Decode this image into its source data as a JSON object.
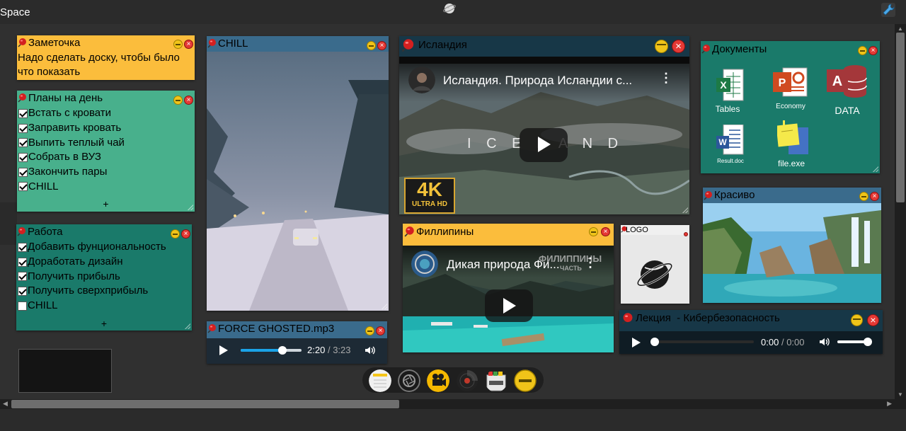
{
  "app": {
    "title": "Space"
  },
  "icons": {
    "logo": "planet-icon",
    "settings": "wrench-icon",
    "pin": "pushpin-icon",
    "minimize": "minus-circle-icon",
    "close": "close-circle-icon"
  },
  "colors": {
    "background": "#2b2b2b",
    "note_yellow": "#fbbd3c",
    "note_green": "#48b08c",
    "note_teal": "#1a7a6a",
    "panel_blue": "#3a6b8c",
    "panel_dark": "#173747",
    "docs_green": "#1a7a6a"
  },
  "note": {
    "title": "Заметочка",
    "text": "Надо сделать доску, чтобы было что показать"
  },
  "daily": {
    "title": "Планы на день",
    "add_label": "+",
    "items": [
      {
        "label": "Встать с кровати",
        "checked": true
      },
      {
        "label": "Заправить кровать",
        "checked": true
      },
      {
        "label": "Выпить теплый чай",
        "checked": true
      },
      {
        "label": "Собрать в ВУЗ",
        "checked": true
      },
      {
        "label": "Закончить пары",
        "checked": true
      },
      {
        "label": "CHILL",
        "checked": true
      }
    ]
  },
  "work": {
    "title": "Работа",
    "add_label": "+",
    "items": [
      {
        "label": "Добавить фунциональность",
        "checked": true
      },
      {
        "label": "Доработать дизайн",
        "checked": true
      },
      {
        "label": "Получить прибыль",
        "checked": true
      },
      {
        "label": "Получить сверхприбыль",
        "checked": true
      },
      {
        "label": "CHILL",
        "checked": false
      }
    ]
  },
  "chill": {
    "title": "CHILL"
  },
  "audio1": {
    "title": "FORCE GHOSTED.mp3",
    "current": "2:20",
    "separator": "/",
    "duration": "3:23",
    "progress": 0.69
  },
  "iceland": {
    "title": "Исландия",
    "video_title": "Исландия. Природа Исландии с...",
    "overlay_text": "I C E L A N D",
    "badge_main": "4K",
    "badge_sub": "ULTRA HD"
  },
  "philippines": {
    "title": "Филлипины",
    "video_title": "Дикая природа Фи...",
    "overlay_text": "ФИЛИППИНЫ",
    "overlay_sub": "ЧАСТЬ"
  },
  "logo_widget": {
    "title": "LOGO"
  },
  "docs": {
    "title": "Документы",
    "files": [
      {
        "label": "Tables",
        "icon": "excel-icon"
      },
      {
        "label": "Economy",
        "icon": "powerpoint-icon"
      },
      {
        "label": "DATA",
        "icon": "access-icon"
      },
      {
        "label": "Result.doc",
        "icon": "word-icon"
      },
      {
        "label": "file.exe",
        "icon": "sticky-note-icon"
      }
    ]
  },
  "beautiful": {
    "title": "Красиво"
  },
  "lecture": {
    "title": "Лекция  - Кибербезопасность",
    "current": "0:00",
    "separator": "/",
    "duration": "0:00",
    "progress": 0,
    "volume": 0.9
  },
  "dock": {
    "items": [
      "note-dock-icon",
      "camera-shutter-icon",
      "video-camera-icon",
      "vinyl-record-icon",
      "folder-archive-icon",
      "minimize-dock-icon"
    ]
  }
}
